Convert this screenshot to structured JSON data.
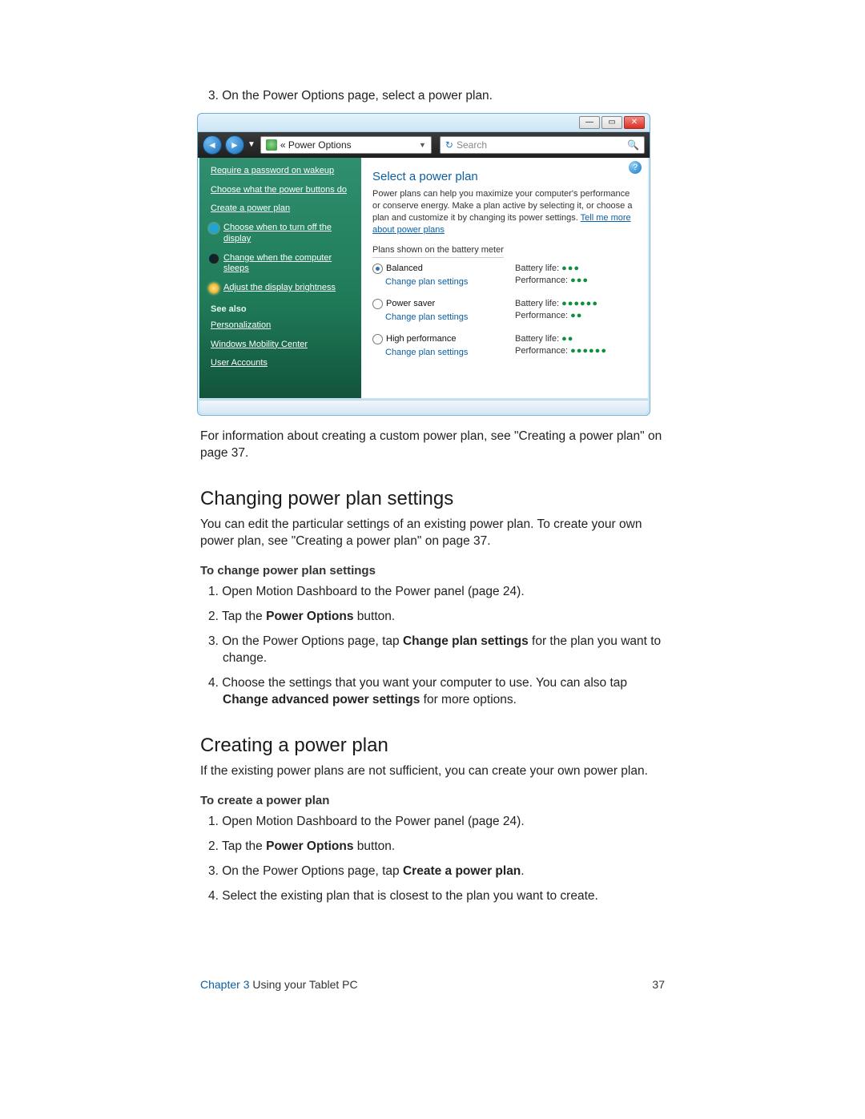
{
  "step3": "3.  On the Power Options page, select a power plan.",
  "window": {
    "breadcrumb": "«  Power Options",
    "searchPlaceholder": "Search",
    "sidebar": {
      "items": [
        "Require a password on wakeup",
        "Choose what the power buttons do",
        "Create a power plan",
        "Choose when to turn off the display",
        "Change when the computer sleeps",
        "Adjust the display brightness"
      ],
      "seeAlsoHead": "See also",
      "seeAlso": [
        "Personalization",
        "Windows Mobility Center",
        "User Accounts"
      ]
    },
    "main": {
      "heading": "Select a power plan",
      "descPre": "Power plans can help you maximize your computer's performance or conserve energy. Make a plan active by selecting it, or choose a plan and customize it by changing its power settings. ",
      "descLink": "Tell me more about power plans",
      "plansLabel": "Plans shown on the battery meter",
      "changeLink": "Change plan settings",
      "batteryLabel": "Battery life:",
      "perfLabel": "Performance:",
      "plans": [
        {
          "name": "Balanced",
          "selected": true,
          "battery": 3,
          "perf": 3
        },
        {
          "name": "Power saver",
          "selected": false,
          "battery": 6,
          "perf": 2
        },
        {
          "name": "High performance",
          "selected": false,
          "battery": 2,
          "perf": 6
        }
      ]
    }
  },
  "afterImg": "For information about creating a custom power plan, see \"Creating a power plan\" on page 37.",
  "sectionA": {
    "title": "Changing power plan settings",
    "intro": "You can edit the particular settings of an existing power plan. To create your own power plan, see \"Creating a power plan\" on page 37.",
    "procTitle": "To change power plan settings",
    "steps": {
      "s1": "1.  Open Motion Dashboard to the Power panel (page 24).",
      "s2a": "2.  Tap the ",
      "s2b": "Power Options",
      "s2c": " button.",
      "s3a": "3.  On the Power Options page, tap ",
      "s3b": "Change plan settings",
      "s3c": " for the plan you want to change.",
      "s4a": "4.  Choose the settings that you want your computer to use. You can also tap ",
      "s4b": "Change advanced power settings",
      "s4c": " for more options."
    }
  },
  "sectionB": {
    "title": "Creating a power plan",
    "intro": "If the existing power plans are not sufficient, you can create your own power plan.",
    "procTitle": "To create a power plan",
    "steps": {
      "s1": "1.  Open Motion Dashboard to the Power panel (page 24).",
      "s2a": "2.  Tap the ",
      "s2b": "Power Options",
      "s2c": " button.",
      "s3a": "3.  On the Power Options page, tap ",
      "s3b": "Create a power plan",
      "s3c": ".",
      "s4": "4.  Select the existing plan that is closest to the plan you want to create."
    }
  },
  "footer": {
    "chapter": "Chapter 3",
    "title": "  Using your Tablet PC",
    "page": "37"
  }
}
